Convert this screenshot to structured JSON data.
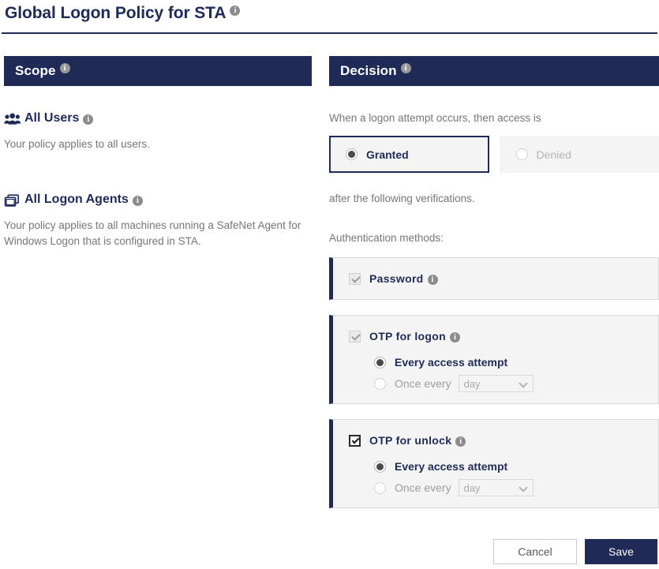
{
  "page": {
    "title": "Global Logon Policy for STA",
    "title_info_tooltip": "info"
  },
  "scope": {
    "header": "Scope",
    "blocks": [
      {
        "icon": "users-icon",
        "heading": "All Users",
        "description": "Your policy applies to all users."
      },
      {
        "icon": "logon-agents-icon",
        "heading": "All Logon Agents",
        "description": "Your policy applies to all machines running a SafeNet Agent for Windows Logon that is configured in STA."
      }
    ]
  },
  "decision": {
    "header": "Decision",
    "intro_text": "When a logon attempt occurs, then access is",
    "after_text": "after the following verifications.",
    "auth_methods_label": "Authentication methods:",
    "access_options": [
      {
        "label": "Granted",
        "selected": true,
        "disabled": false
      },
      {
        "label": "Denied",
        "selected": false,
        "disabled": true
      }
    ],
    "methods": [
      {
        "label": "Password",
        "checked": true,
        "checkbox_state": "disabled-checked",
        "has_frequency": false
      },
      {
        "label": "OTP for logon",
        "checked": true,
        "checkbox_state": "disabled-checked",
        "has_frequency": true,
        "frequency": {
          "every_label": "Every access attempt",
          "every_selected": true,
          "once_label": "Once every",
          "once_selected": false,
          "interval_value": "day",
          "interval_options": [
            "day"
          ]
        }
      },
      {
        "label": "OTP for unlock",
        "checked": true,
        "checkbox_state": "enabled-checked",
        "has_frequency": true,
        "frequency": {
          "every_label": "Every access attempt",
          "every_selected": true,
          "once_label": "Once every",
          "once_selected": false,
          "interval_value": "day",
          "interval_options": [
            "day"
          ]
        }
      }
    ]
  },
  "footer": {
    "cancel_label": "Cancel",
    "save_label": "Save"
  },
  "colors": {
    "navy": "#1f2b56",
    "panel_bg": "#f4f4f4",
    "body_text": "#767676",
    "disabled_text": "#b6b6b6"
  }
}
